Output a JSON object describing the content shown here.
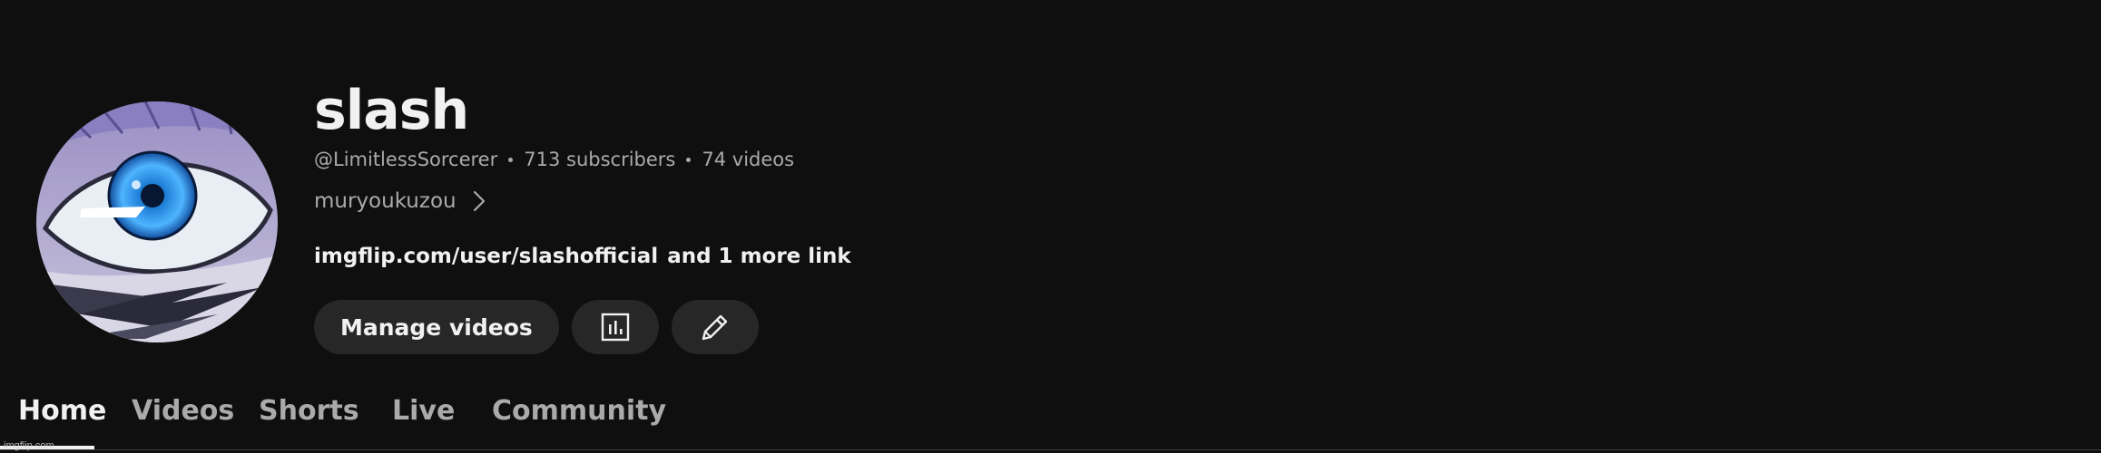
{
  "channel": {
    "name": "slash",
    "handle": "@LimitlessSorcerer",
    "subscribers": "713 subscribers",
    "videos": "74 videos",
    "description": "muryoukuzou",
    "link_url": "imgflip.com/user/slashofficial",
    "link_more": "and 1 more link"
  },
  "actions": {
    "manage_videos_label": "Manage videos",
    "analytics_icon": "analytics-icon",
    "edit_icon": "pencil-icon"
  },
  "tabs": [
    {
      "label": "Home",
      "active": true
    },
    {
      "label": "Videos",
      "active": false
    },
    {
      "label": "Shorts",
      "active": false
    },
    {
      "label": "Live",
      "active": false
    },
    {
      "label": "Community",
      "active": false
    }
  ],
  "watermark": "imgflip.com",
  "colors": {
    "background": "#0f0f0f",
    "text_primary": "#f1f1f1",
    "text_secondary": "#aaaaaa",
    "button_bg": "#272727"
  }
}
